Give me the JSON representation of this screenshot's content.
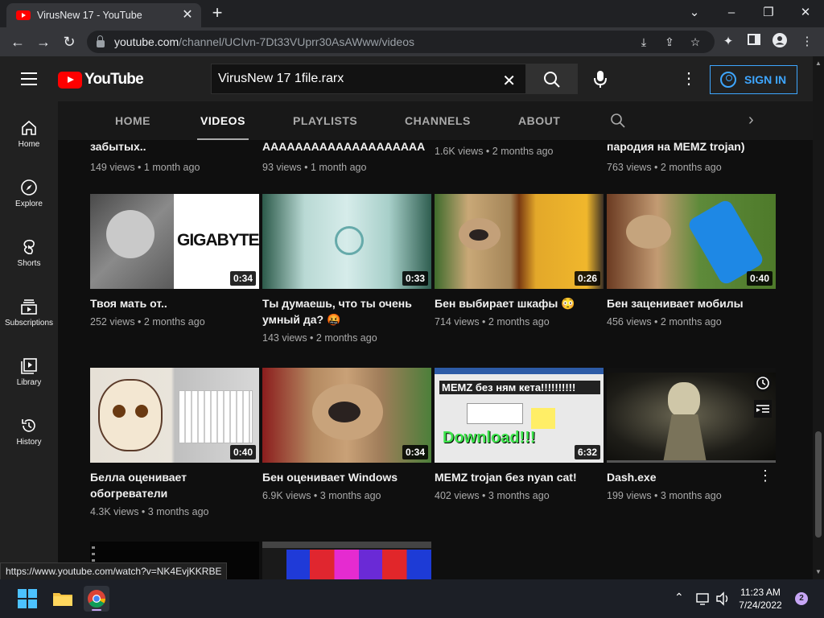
{
  "browser": {
    "tab_title": "VirusNew 17 - YouTube",
    "url_host": "youtube.com",
    "url_path": "/channel/UCIvn-7Dt33VUprr30AsAWww/videos",
    "status_url": "https://www.youtube.com/watch?v=NK4EvjKKRBE"
  },
  "header": {
    "logo_text": "YouTube",
    "search_value": "VirusNew 17 1file.rarx",
    "sign_in": "SIGN IN"
  },
  "sidebar": {
    "items": [
      {
        "label": "Home",
        "icon": "home-icon"
      },
      {
        "label": "Explore",
        "icon": "compass-icon"
      },
      {
        "label": "Shorts",
        "icon": "shorts-icon"
      },
      {
        "label": "Subscriptions",
        "icon": "subscriptions-icon"
      },
      {
        "label": "Library",
        "icon": "library-icon"
      },
      {
        "label": "History",
        "icon": "history-icon"
      }
    ]
  },
  "channel_tabs": [
    "HOME",
    "VIDEOS",
    "PLAYLISTS",
    "CHANNELS",
    "ABOUT"
  ],
  "top_row": [
    {
      "title": "забытых..",
      "meta": "149 views • 1 month ago"
    },
    {
      "title": "АААААААААААААААААААА",
      "meta": "93 views • 1 month ago"
    },
    {
      "title": "",
      "meta": "1.6K views • 2 months ago"
    },
    {
      "title": "пародия на MEMZ trojan)",
      "meta": "763 views • 2 months ago"
    }
  ],
  "videos": [
    {
      "title": "Твоя мать от..",
      "meta": "252 views • 2 months ago",
      "duration": "0:34",
      "thumb_text": "GIGABYTE"
    },
    {
      "title": "Ты думаешь, что ты очень умный да? 🤬",
      "meta": "143 views • 2 months ago",
      "duration": "0:33"
    },
    {
      "title": "Бен выбирает шкафы 😳",
      "meta": "714 views • 2 months ago",
      "duration": "0:26"
    },
    {
      "title": "Бен заценивает мобилы",
      "meta": "456 views • 2 months ago",
      "duration": "0:40"
    },
    {
      "title": "Белла оценивает обогреватели",
      "meta": "4.3K views • 3 months ago",
      "duration": "0:40"
    },
    {
      "title": "Бен оценивает Windows",
      "meta": "6.9K views • 3 months ago",
      "duration": "0:34"
    },
    {
      "title": "MEMZ trojan без nyan cat!",
      "meta": "402 views • 3 months ago",
      "duration": "6:32",
      "thumb_text_top": "MEMZ без ням кета!!!!!!!!!!",
      "thumb_text_bottom": "Download!!!"
    },
    {
      "title": "Dash.exe",
      "meta": "199 views • 3 months ago",
      "duration": ""
    }
  ],
  "taskbar": {
    "time": "11:23 AM",
    "date": "7/24/2022",
    "notifications": "2"
  },
  "colors": {
    "youtube_red": "#ff0000",
    "sign_in_blue": "#3ea6ff",
    "background": "#0f0f0f"
  }
}
